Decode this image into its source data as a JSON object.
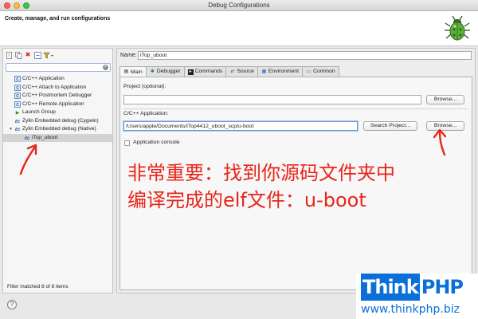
{
  "window": {
    "title": "Debug Configurations"
  },
  "header": {
    "title": "Create, manage, and run configurations",
    "logo_icon": "bug-icon"
  },
  "toolbar": {
    "buttons": [
      {
        "name": "new-config-button",
        "glyph": "📄"
      },
      {
        "name": "duplicate-button",
        "glyph": "⧉"
      },
      {
        "name": "delete-button",
        "glyph": "✖"
      },
      {
        "name": "collapse-all-button",
        "glyph": "⊟"
      },
      {
        "name": "filter-button",
        "glyph": "⛃▾"
      }
    ]
  },
  "filter": {
    "value": "",
    "placeholder": ""
  },
  "tree": {
    "items": [
      {
        "label": "C/C++ Application",
        "icon": "c-icon"
      },
      {
        "label": "C/C++ Attach to Application",
        "icon": "c-icon"
      },
      {
        "label": "C/C++ Postmortem Debugger",
        "icon": "c-icon"
      },
      {
        "label": "C/C++ Remote Application",
        "icon": "c-icon"
      },
      {
        "label": "Launch Group",
        "icon": "launch-icon"
      },
      {
        "label": "Zylin Embedded debug (Cygwin)",
        "icon": "zylin-icon"
      },
      {
        "label": "Zylin Embedded debug (Native)",
        "icon": "zylin-icon",
        "expanded": true
      },
      {
        "label": "iTop_uboot",
        "icon": "zylin-icon",
        "selected": true,
        "child": true
      }
    ]
  },
  "status": {
    "filter_text": "Filter matched 8 of 8 items"
  },
  "config": {
    "name_label": "Name:",
    "name_value": "iTop_uboot",
    "tabs": [
      {
        "label": "Main",
        "icon": "main-tab-icon",
        "glyph": "▤",
        "active": true
      },
      {
        "label": "Debugger",
        "icon": "debugger-tab-icon",
        "glyph": "✱"
      },
      {
        "label": "Commands",
        "icon": "commands-tab-icon",
        "glyph": "▶"
      },
      {
        "label": "Source",
        "icon": "source-tab-icon",
        "glyph": "⇄"
      },
      {
        "label": "Environment",
        "icon": "environment-tab-icon",
        "glyph": "▦"
      },
      {
        "label": "Common",
        "icon": "common-tab-icon",
        "glyph": "▭"
      }
    ],
    "project_label": "Project (optional):",
    "project_value": "",
    "browse_project_label": "Browse...",
    "app_label": "C/C++ Application:",
    "app_value": "/Users/apple/Documents/iTop4412_uboot_scp/u-boot",
    "search_project_label": "Search Project...",
    "browse_app_label": "Browse...",
    "app_console_label": "Application console",
    "app_console_checked": false
  },
  "annotation": {
    "line1": "非常重要：找到你源码文件夹中",
    "line2": "编译完成的elf文件：u-boot",
    "color": "#e8251a"
  },
  "help": {
    "glyph": "?"
  },
  "watermark": {
    "think": "Think",
    "php": "PHP",
    "url": "www.thinkphp.biz",
    "color": "#0b6fd8"
  }
}
